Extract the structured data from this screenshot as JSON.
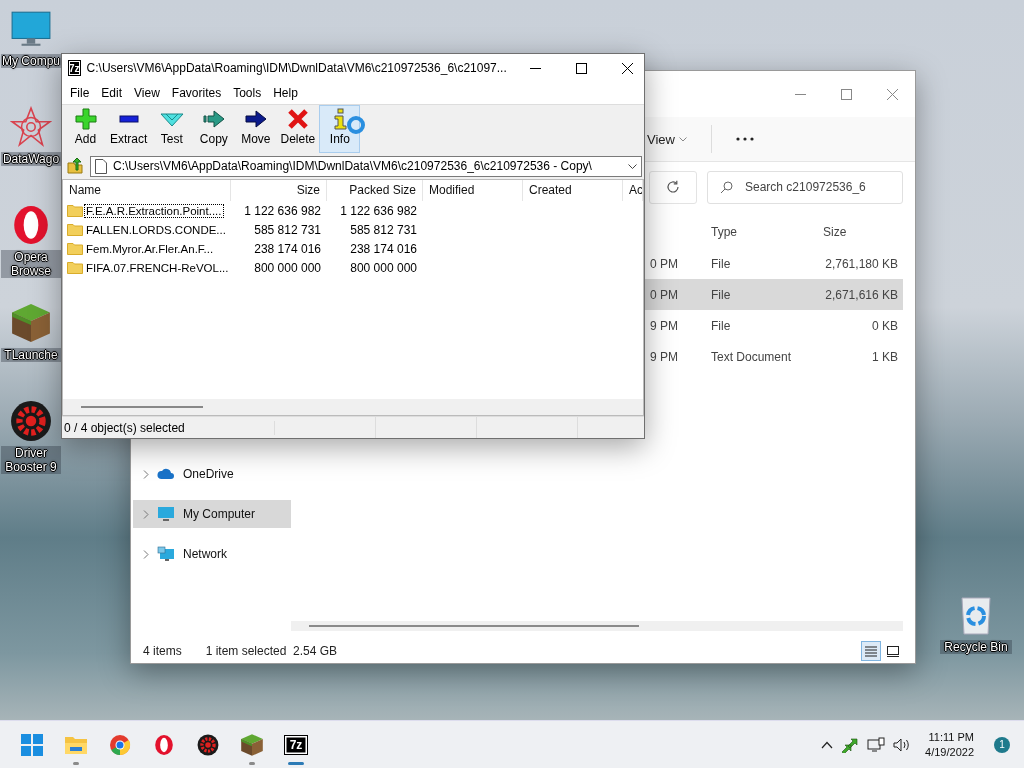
{
  "desktop_icons": [
    {
      "label": "My Compu",
      "kind": "computer"
    },
    {
      "label": "DataWago",
      "kind": "star"
    },
    {
      "label": "Opera Browse",
      "kind": "opera"
    },
    {
      "label": "TLaunche",
      "kind": "block"
    },
    {
      "label": "Driver Booster 9",
      "kind": "gear"
    }
  ],
  "recycle_bin": {
    "label": "Recycle Bin"
  },
  "explorer": {
    "view_label": "View",
    "search": {
      "placeholder": "Search c210972536_6"
    },
    "columns": [
      "Type",
      "Size"
    ],
    "rows": [
      {
        "modified": "0 PM",
        "type": "File",
        "size": "2,761,180 KB",
        "selected": false
      },
      {
        "modified": "0 PM",
        "type": "File",
        "size": "2,671,616 KB",
        "selected": true
      },
      {
        "modified": "9 PM",
        "type": "File",
        "size": "0 KB",
        "selected": false
      },
      {
        "modified": "9 PM",
        "type": "Text Document",
        "size": "1 KB",
        "selected": false
      }
    ],
    "nav": [
      {
        "label": "OneDrive",
        "kind": "cloud",
        "selected": false
      },
      {
        "label": "My Computer",
        "kind": "computer",
        "selected": true
      },
      {
        "label": "Network",
        "kind": "network",
        "selected": false
      }
    ],
    "status": {
      "count": "4 items",
      "selection": "1 item selected",
      "size": "2.54 GB"
    },
    "view_modes": [
      {
        "kind": "details",
        "selected": true
      },
      {
        "kind": "tiles",
        "selected": false
      }
    ]
  },
  "archiver": {
    "title": "C:\\Users\\VM6\\AppData\\Roaming\\IDM\\DwnlData\\VM6\\c210972536_6\\c21097...",
    "logo": "7z",
    "menu": [
      "File",
      "Edit",
      "View",
      "Favorites",
      "Tools",
      "Help"
    ],
    "toolbar": [
      {
        "label": "Add",
        "kind": "add",
        "hovered": false
      },
      {
        "label": "Extract",
        "kind": "extract",
        "hovered": false
      },
      {
        "label": "Test",
        "kind": "test",
        "hovered": false
      },
      {
        "label": "Copy",
        "kind": "copy",
        "hovered": false
      },
      {
        "label": "Move",
        "kind": "move",
        "hovered": false
      },
      {
        "label": "Delete",
        "kind": "delete",
        "hovered": false
      },
      {
        "label": "Info",
        "kind": "info",
        "hovered": true
      }
    ],
    "path": "C:\\Users\\VM6\\AppData\\Roaming\\IDM\\DwnlData\\VM6\\c210972536_6\\c210972536 - Copy\\",
    "columns": [
      "Name",
      "Size",
      "Packed Size",
      "Modified",
      "Created",
      "Ac"
    ],
    "rows": [
      {
        "name": "F.E.A.R.Extraction.Point....",
        "size": "1 122 636 982",
        "packed": "1 122 636 982",
        "focused": true
      },
      {
        "name": "FALLEN.LORDS.CONDE...",
        "size": "585 812 731",
        "packed": "585 812 731",
        "focused": false
      },
      {
        "name": "Fem.Myror.Ar.Fler.An.F...",
        "size": "238 174 016",
        "packed": "238 174 016",
        "focused": false
      },
      {
        "name": "FIFA.07.FRENCH-ReVOL...",
        "size": "800 000 000",
        "packed": "800 000 000",
        "focused": false
      }
    ],
    "status": "0 / 4 object(s) selected"
  },
  "taskbar": {
    "apps": [
      {
        "kind": "start",
        "running": false,
        "selected": false
      },
      {
        "kind": "explorer",
        "running": true,
        "selected": false
      },
      {
        "kind": "chrome",
        "running": false,
        "selected": false
      },
      {
        "kind": "opera",
        "running": false,
        "selected": false
      },
      {
        "kind": "gear",
        "running": false,
        "selected": false
      },
      {
        "kind": "block",
        "running": true,
        "selected": false
      },
      {
        "kind": "archiver",
        "text": "7z",
        "running": true,
        "selected": true
      }
    ],
    "time": "11:11 PM",
    "date": "4/19/2022",
    "notifications": "1"
  }
}
